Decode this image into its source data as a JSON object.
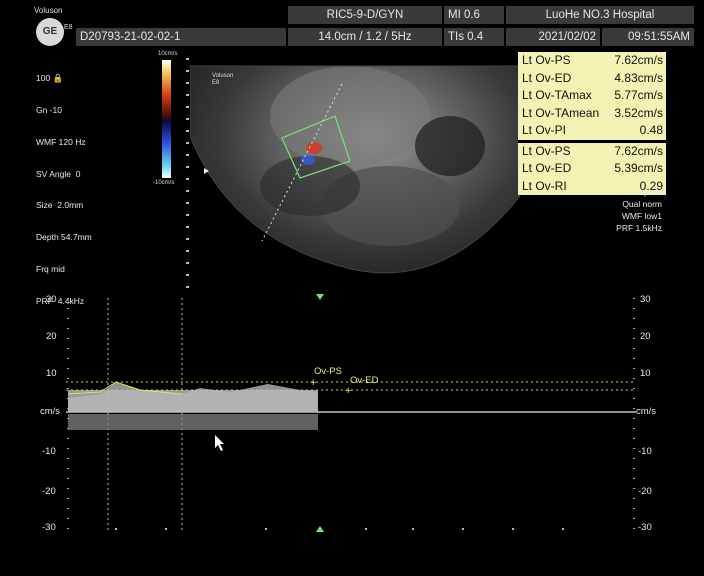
{
  "header": {
    "brand": "Voluson",
    "model": "E8",
    "logo": "GE",
    "probe": "RIC5-9-D/GYN",
    "mi": "MI  0.6",
    "hospital": "LuoHe NO.3 Hospital",
    "patient_id": "D20793-21-02-02-1",
    "imaging": "14.0cm / 1.2 / 5Hz",
    "tis": "TIs  0.4",
    "date": "2021/02/02",
    "time": "09:51:55AM"
  },
  "params": [
    "100 🔒",
    "Gn -10",
    "WMF 120 Hz",
    "SV Angle  0",
    "Size  2.0mm",
    "Depth 54.7mm",
    "Frq mid",
    "PRF  4.4kHz"
  ],
  "color_bar": {
    "top": "10cm/s",
    "bottom": "-10cm/s"
  },
  "image_badge": {
    "brand": "Voluson",
    "model": "E8"
  },
  "measurements_group1": [
    {
      "label": "Lt Ov-PS",
      "value": "7.62cm/s"
    },
    {
      "label": "Lt Ov-ED",
      "value": "4.83cm/s"
    },
    {
      "label": "Lt Ov-TAmax",
      "value": "5.77cm/s"
    },
    {
      "label": "Lt Ov-TAmean",
      "value": "3.52cm/s"
    },
    {
      "label": "Lt Ov-PI",
      "value": "0.48"
    }
  ],
  "measurements_group2": [
    {
      "label": "Lt Ov-PS",
      "value": "7.62cm/s"
    },
    {
      "label": "Lt Ov-ED",
      "value": "5.39cm/s"
    },
    {
      "label": "Lt Ov-RI",
      "value": "0.29"
    }
  ],
  "doppler_setup": [
    "Frq mid",
    "Qual norm",
    "WMF low1",
    "PRF  1.5kHz"
  ],
  "spectral": {
    "scale_ticks": [
      "30",
      "20",
      "10",
      "cm/s",
      "-10",
      "-20",
      "-30"
    ],
    "unit": "cm/s",
    "annotation_ps": "Ov-PS",
    "annotation_ed": "Ov-ED"
  },
  "colors": {
    "highlight": "#f3f2b3",
    "header_bg": "#3a3a3a",
    "trace": "#e6e64a"
  }
}
